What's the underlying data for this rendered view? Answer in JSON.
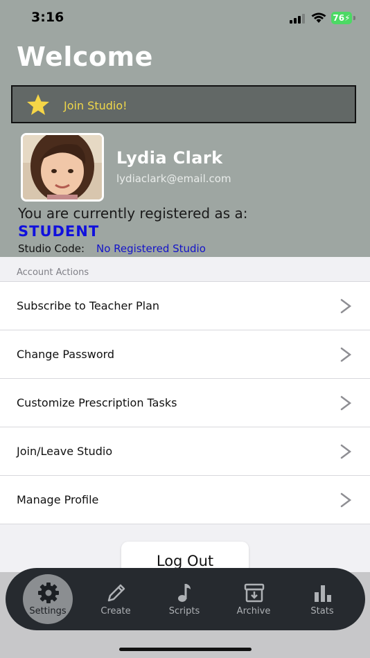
{
  "status_bar": {
    "time": "3:16",
    "battery": "76"
  },
  "header": {
    "title": "Welcome",
    "join_banner": {
      "label": "Join Studio!",
      "icon": "star-icon",
      "icon_color": "#f5d547"
    },
    "user": {
      "name": "Lydia Clark",
      "email": "lydiaclark@email.com"
    },
    "registration_text": "You are currently registered as a:",
    "role": "STUDENT",
    "studio_code_label": "Studio Code:",
    "studio_code_value": "No Registered Studio"
  },
  "account_actions": {
    "section_title": "Account Actions",
    "items": [
      {
        "label": "Subscribe to Teacher Plan"
      },
      {
        "label": "Change Password"
      },
      {
        "label": "Customize Prescription Tasks"
      },
      {
        "label": "Join/Leave Studio"
      },
      {
        "label": "Manage Profile"
      }
    ]
  },
  "logout_label": "Log Out",
  "tabbar": {
    "active": "Settings",
    "tabs": [
      {
        "label": "Settings",
        "icon": "gear-icon"
      },
      {
        "label": "Create",
        "icon": "pencil-icon"
      },
      {
        "label": "Scripts",
        "icon": "music-note-icon"
      },
      {
        "label": "Archive",
        "icon": "archive-icon"
      },
      {
        "label": "Stats",
        "icon": "bar-chart-icon"
      }
    ]
  },
  "colors": {
    "header_bg": "#9ea6a2",
    "role_color": "#1010dd",
    "link_color": "#1414c8",
    "tabbar_bg": "#262a2f",
    "join_text": "#f0d84a"
  }
}
